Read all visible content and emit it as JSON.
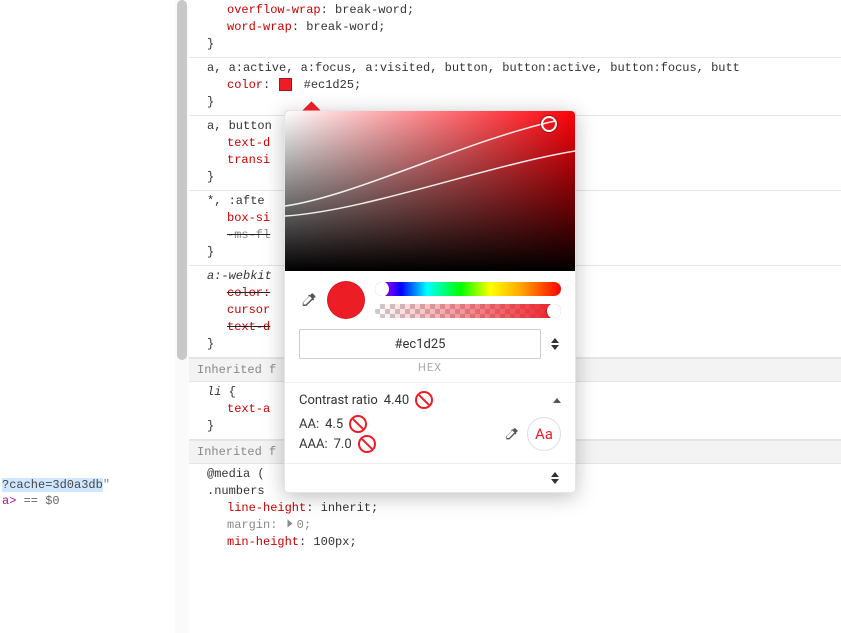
{
  "breadcrumb": {
    "hl_text": "?cache=3d0a3db",
    "quote": "\"",
    "tag_close_a": "a",
    "eq_text": " == $0"
  },
  "rules": {
    "r0_prop1": "overflow-wrap",
    "r0_val1": "break-word",
    "r0_prop2": "word-wrap",
    "r0_val2": "break-word",
    "r1_sel": "a, a:active, a:focus, a:visited, button, button:active, button:focus, butt",
    "r1_prop": "color",
    "r1_val": "#ec1d25",
    "r2_sel": "a, button",
    "r2_prop1": "text-d",
    "r2_prop2": "transi",
    "r3_sel": "*, :afte",
    "r3_prop1": "box-si",
    "r3_prop2": "-ms-fl",
    "r4_sel": "a:-webkit",
    "r4_prop1": "color:",
    "r4_prop2": "cursor",
    "r4_prop3": "text-d",
    "hdr1": "Inherited f",
    "r5_sel": "li",
    "r5_prop": "text-a",
    "hdr2": "Inherited f",
    "r6_sel": "@media (",
    "r6_sel2": ".numbers",
    "r6_prop1": "line-height",
    "r6_val1": "inherit",
    "r6_prop2": "margin",
    "r6_val2": "0",
    "r6_prop3": "min-height",
    "r6_val3": "100px"
  },
  "picker": {
    "swatch_hex": "#ec1d25",
    "hex_value": "#ec1d25",
    "hex_label": "HEX",
    "contrast_label": "Contrast ratio",
    "contrast_value": "4.40",
    "aa_label": "AA:",
    "aa_value": "4.5",
    "aaa_label": "AAA:",
    "aaa_value": "7.0",
    "aa_btn": "Aa"
  }
}
